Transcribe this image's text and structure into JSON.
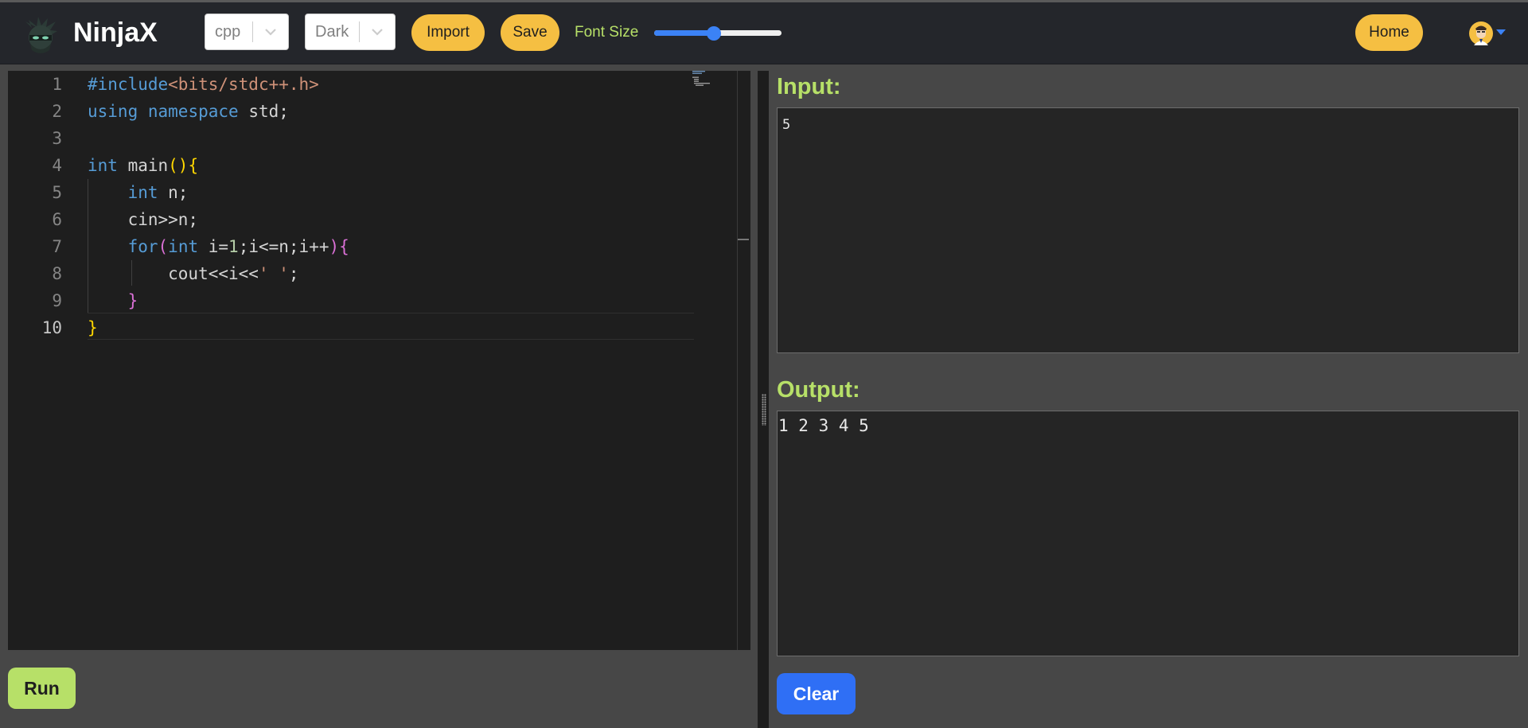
{
  "app": {
    "brand": "NinjaX"
  },
  "toolbar": {
    "language_value": "cpp",
    "theme_value": "Dark",
    "import_label": "Import",
    "save_label": "Save",
    "font_size_label": "Font Size",
    "font_size_slider_fraction": 0.47,
    "home_label": "Home"
  },
  "editor": {
    "active_line": 10,
    "lines": [
      {
        "number": "1",
        "tokens": [
          {
            "t": "#include",
            "c": "tk-blue"
          },
          {
            "t": "<bits/stdc++.h>",
            "c": "tk-str"
          }
        ]
      },
      {
        "number": "2",
        "tokens": [
          {
            "t": "using",
            "c": "tk-kw"
          },
          {
            "t": " ",
            "c": ""
          },
          {
            "t": "namespace",
            "c": "tk-kw"
          },
          {
            "t": " std;",
            "c": ""
          }
        ]
      },
      {
        "number": "3",
        "tokens": []
      },
      {
        "number": "4",
        "tokens": [
          {
            "t": "int",
            "c": "tk-type"
          },
          {
            "t": " main",
            "c": ""
          },
          {
            "t": "(){",
            "c": "tk-gold"
          }
        ]
      },
      {
        "number": "5",
        "tokens": [
          {
            "t": "    ",
            "c": ""
          },
          {
            "t": "int",
            "c": "tk-type"
          },
          {
            "t": " n;",
            "c": ""
          }
        ]
      },
      {
        "number": "6",
        "tokens": [
          {
            "t": "    cin>>n;",
            "c": ""
          }
        ]
      },
      {
        "number": "7",
        "tokens": [
          {
            "t": "    ",
            "c": ""
          },
          {
            "t": "for",
            "c": "tk-kw"
          },
          {
            "t": "(",
            "c": "tk-pink"
          },
          {
            "t": "int",
            "c": "tk-type"
          },
          {
            "t": " i=",
            "c": ""
          },
          {
            "t": "1",
            "c": "tk-num"
          },
          {
            "t": ";i<=n;i++",
            "c": ""
          },
          {
            "t": "){",
            "c": "tk-pink"
          }
        ]
      },
      {
        "number": "8",
        "tokens": [
          {
            "t": "        cout<<i<<",
            "c": ""
          },
          {
            "t": "' '",
            "c": "tk-str"
          },
          {
            "t": ";",
            "c": ""
          }
        ]
      },
      {
        "number": "9",
        "tokens": [
          {
            "t": "    ",
            "c": ""
          },
          {
            "t": "}",
            "c": "tk-pink"
          }
        ]
      },
      {
        "number": "10",
        "tokens": [
          {
            "t": "}",
            "c": "tk-gold"
          }
        ]
      }
    ]
  },
  "input": {
    "label": "Input:",
    "value": "5"
  },
  "output": {
    "label": "Output:",
    "value": "1 2 3 4 5"
  },
  "actions": {
    "run_label": "Run",
    "clear_label": "Clear"
  },
  "colors": {
    "accent_yellow": "#f5bf42",
    "accent_green": "#b7e068",
    "accent_blue": "#2f6ff5",
    "navbar_bg": "#24262b",
    "editor_bg": "#1e1e1e"
  }
}
